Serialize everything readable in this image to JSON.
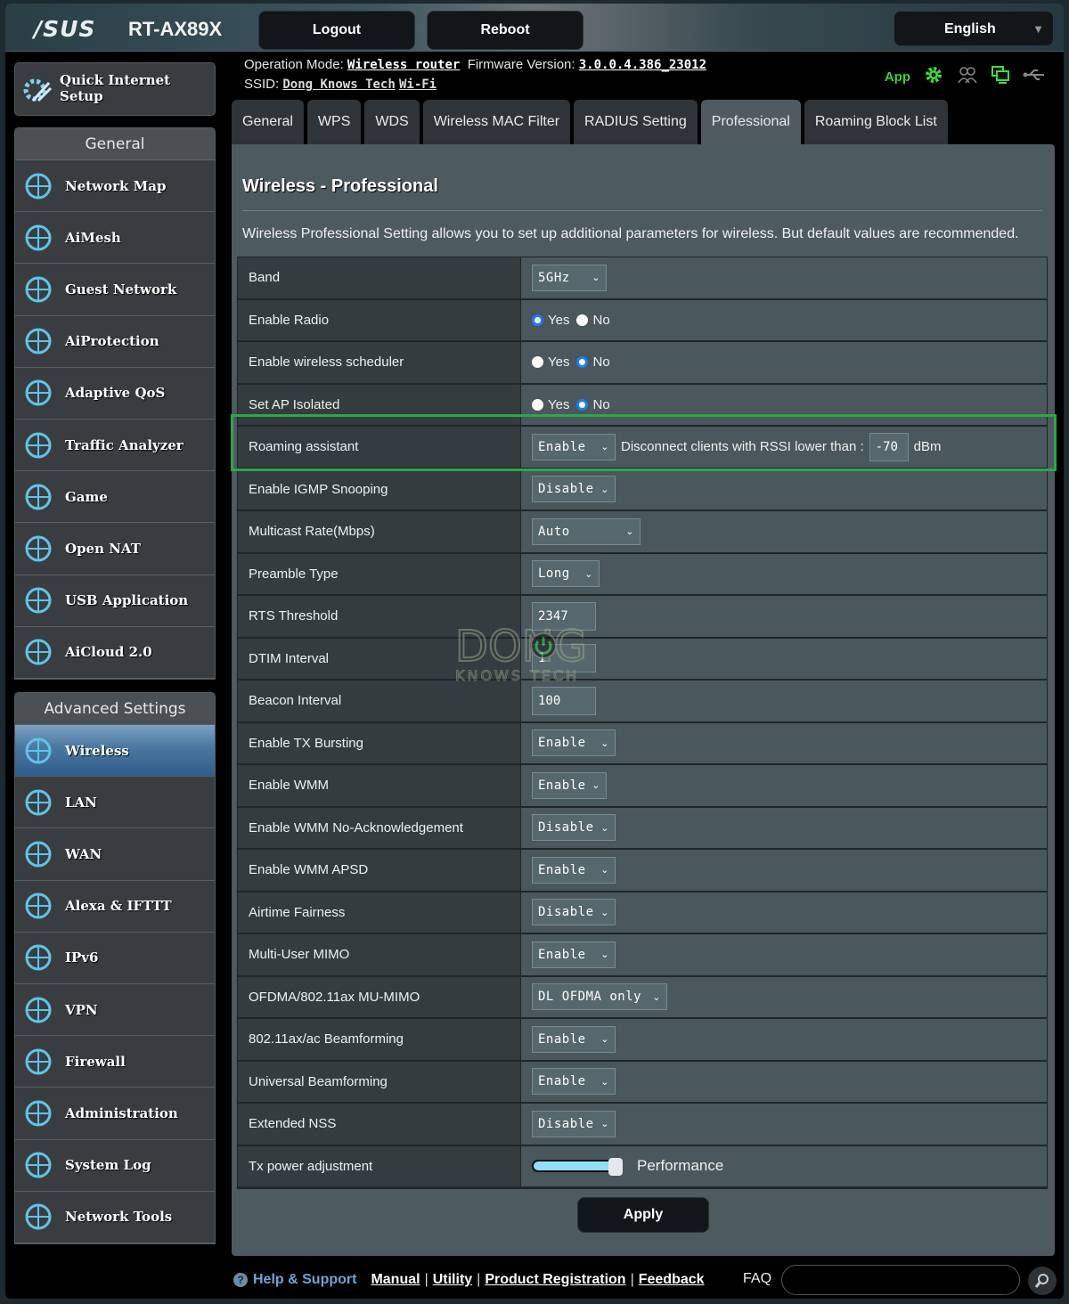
{
  "header": {
    "brand": "/SUS",
    "model": "RT-AX89X",
    "logout_label": "Logout",
    "reboot_label": "Reboot",
    "language": "English"
  },
  "status": {
    "operation_mode_label": "Operation Mode:",
    "operation_mode_value": "Wireless router",
    "firmware_label": "Firmware Version:",
    "firmware_value": "3.0.0.4.386_23012",
    "ssid_label": "SSID:",
    "ssid_value_1": "Dong Knows Tech",
    "ssid_value_2": "Wi-Fi",
    "app_label": "App",
    "icons": [
      "gear-icon",
      "clients-icon",
      "network-status-icon",
      "usb-icon"
    ]
  },
  "sidebar": {
    "quick_setup": "Quick Internet Setup",
    "general_heading": "General",
    "general_items": [
      {
        "label": "Network Map",
        "icon": "network-map-icon"
      },
      {
        "label": "AiMesh",
        "icon": "aimesh-icon"
      },
      {
        "label": "Guest Network",
        "icon": "guest-network-icon"
      },
      {
        "label": "AiProtection",
        "icon": "aiprotection-icon"
      },
      {
        "label": "Adaptive QoS",
        "icon": "adaptive-qos-icon"
      },
      {
        "label": "Traffic Analyzer",
        "icon": "traffic-analyzer-icon"
      },
      {
        "label": "Game",
        "icon": "game-icon"
      },
      {
        "label": "Open NAT",
        "icon": "open-nat-icon"
      },
      {
        "label": "USB Application",
        "icon": "usb-application-icon"
      },
      {
        "label": "AiCloud 2.0",
        "icon": "aicloud-icon"
      }
    ],
    "advanced_heading": "Advanced Settings",
    "advanced_items": [
      {
        "label": "Wireless",
        "icon": "wireless-icon",
        "active": true
      },
      {
        "label": "LAN",
        "icon": "lan-icon"
      },
      {
        "label": "WAN",
        "icon": "wan-icon"
      },
      {
        "label": "Alexa & IFTTT",
        "icon": "alexa-ifttt-icon"
      },
      {
        "label": "IPv6",
        "icon": "ipv6-icon"
      },
      {
        "label": "VPN",
        "icon": "vpn-icon"
      },
      {
        "label": "Firewall",
        "icon": "firewall-icon"
      },
      {
        "label": "Administration",
        "icon": "administration-icon"
      },
      {
        "label": "System Log",
        "icon": "system-log-icon"
      },
      {
        "label": "Network Tools",
        "icon": "network-tools-icon"
      }
    ]
  },
  "tabs": [
    {
      "label": "General"
    },
    {
      "label": "WPS"
    },
    {
      "label": "WDS"
    },
    {
      "label": "Wireless MAC Filter"
    },
    {
      "label": "RADIUS Setting"
    },
    {
      "label": "Professional",
      "active": true
    },
    {
      "label": "Roaming Block List"
    }
  ],
  "panel": {
    "title": "Wireless - Professional",
    "description": "Wireless Professional Setting allows you to set up additional parameters for wireless. But default values are recommended.",
    "settings": {
      "band": {
        "label": "Band",
        "value": "5GHz"
      },
      "enable_radio": {
        "label": "Enable Radio",
        "yes": "Yes",
        "no": "No",
        "selected": "Yes"
      },
      "wireless_scheduler": {
        "label": "Enable wireless scheduler",
        "yes": "Yes",
        "no": "No",
        "selected": "No"
      },
      "ap_isolated": {
        "label": "Set AP Isolated",
        "yes": "Yes",
        "no": "No",
        "selected": "No"
      },
      "roaming_assistant": {
        "label": "Roaming assistant",
        "value": "Enable",
        "rssi_text": "Disconnect clients with RSSI lower than :",
        "rssi_value": "-70",
        "unit": "dBm"
      },
      "igmp_snooping": {
        "label": "Enable IGMP Snooping",
        "value": "Disable"
      },
      "multicast_rate": {
        "label": "Multicast Rate(Mbps)",
        "value": "Auto"
      },
      "preamble_type": {
        "label": "Preamble Type",
        "value": "Long"
      },
      "rts_threshold": {
        "label": "RTS Threshold",
        "value": "2347"
      },
      "dtim_interval": {
        "label": "DTIM Interval",
        "value": "1"
      },
      "beacon_interval": {
        "label": "Beacon Interval",
        "value": "100"
      },
      "tx_bursting": {
        "label": "Enable TX Bursting",
        "value": "Enable"
      },
      "wmm": {
        "label": "Enable WMM",
        "value": "Enable"
      },
      "wmm_noack": {
        "label": "Enable WMM No-Acknowledgement",
        "value": "Disable"
      },
      "wmm_apsd": {
        "label": "Enable WMM APSD",
        "value": "Enable"
      },
      "airtime_fairness": {
        "label": "Airtime Fairness",
        "value": "Disable"
      },
      "mu_mimo": {
        "label": "Multi-User MIMO",
        "value": "Enable"
      },
      "ofdma": {
        "label": "OFDMA/802.11ax MU-MIMO",
        "value": "DL OFDMA only"
      },
      "beamforming": {
        "label": "802.11ax/ac Beamforming",
        "value": "Enable"
      },
      "universal_beamforming": {
        "label": "Universal Beamforming",
        "value": "Enable"
      },
      "extended_nss": {
        "label": "Extended NSS",
        "value": "Disable"
      },
      "tx_power": {
        "label": "Tx power adjustment",
        "value_label": "Performance",
        "level": 1.0
      }
    },
    "apply_label": "Apply"
  },
  "watermark": {
    "line1": "DONG",
    "line2": "KNOWS TECH"
  },
  "footer": {
    "help_label": "Help & Support",
    "links": [
      "Manual",
      "Utility",
      "Product Registration",
      "Feedback"
    ],
    "faq_label": "FAQ"
  },
  "accent_colors": {
    "highlight_box": "#2aa84a",
    "app_green": "#3bd23b",
    "radio_selected": "#1e7bf0",
    "active_menu": "#4d7aa3"
  }
}
